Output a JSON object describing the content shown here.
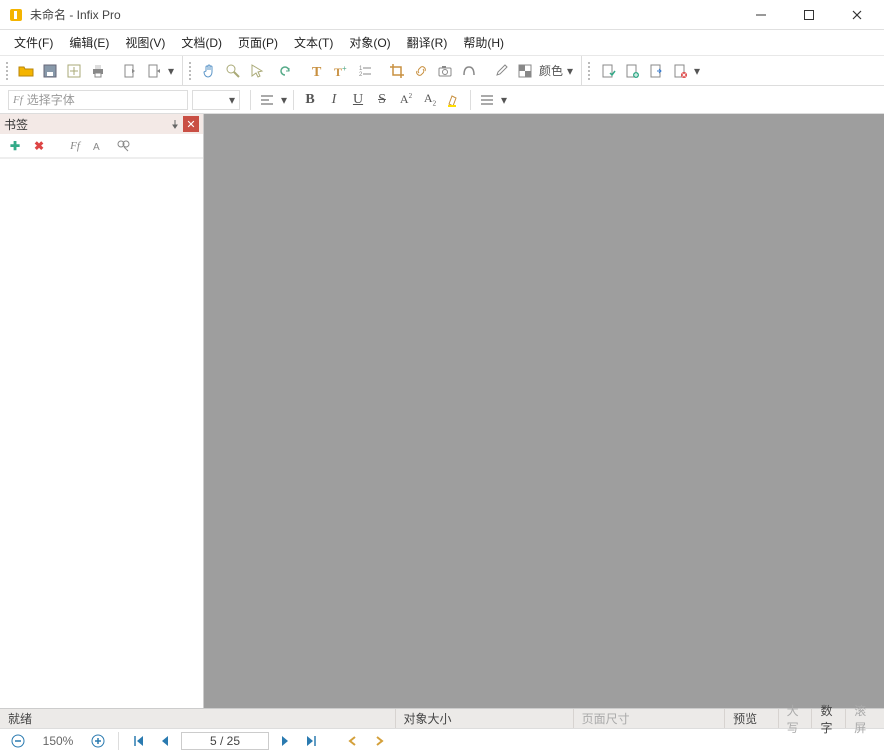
{
  "window": {
    "title": "未命名 - Infix Pro"
  },
  "menu": {
    "file": "文件(F)",
    "edit": "编辑(E)",
    "view": "视图(V)",
    "doc": "文档(D)",
    "page": "页面(P)",
    "text": "文本(T)",
    "object": "对象(O)",
    "translate": "翻译(R)",
    "help": "帮助(H)"
  },
  "toolbar": {
    "color_label": "颜色"
  },
  "format": {
    "font_placeholder": "选择字体",
    "ff_prefix": "Ff"
  },
  "panel": {
    "title": "书签",
    "ff_label": "Ff"
  },
  "status": {
    "ready": "就绪",
    "object_size": "对象大小",
    "page_size": "页面尺寸",
    "preview": "预览",
    "caps": "大写",
    "num": "数字",
    "scroll": "滚屏"
  },
  "nav": {
    "zoom": "150%",
    "page": "5 / 25"
  }
}
